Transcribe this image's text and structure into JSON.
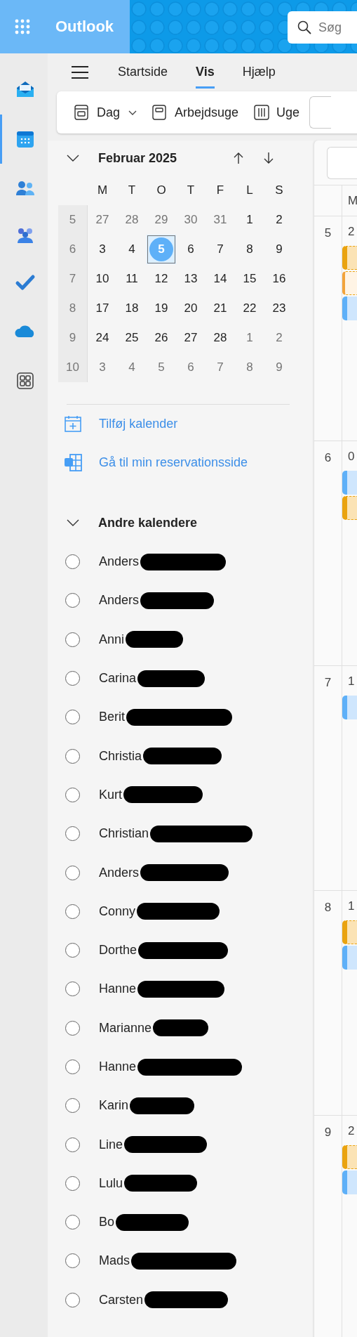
{
  "app": {
    "title": "Outlook"
  },
  "search": {
    "placeholder": "Søg"
  },
  "rail": [
    {
      "kind": "mail",
      "selected": false
    },
    {
      "kind": "calendar",
      "selected": true
    },
    {
      "kind": "people",
      "selected": false
    },
    {
      "kind": "teams",
      "selected": false
    },
    {
      "kind": "todo",
      "selected": false
    },
    {
      "kind": "onedrive",
      "selected": false
    },
    {
      "kind": "apps",
      "selected": false
    }
  ],
  "tabs": [
    {
      "label": "Startside",
      "selected": false
    },
    {
      "label": "Vis",
      "selected": true
    },
    {
      "label": "Hjælp",
      "selected": false
    }
  ],
  "toolbar": [
    {
      "kind": "day",
      "label": "Dag",
      "dropdown": true
    },
    {
      "kind": "workweek",
      "label": "Arbejdsuge",
      "dropdown": false
    },
    {
      "kind": "week",
      "label": "Uge",
      "dropdown": false
    },
    {
      "kind": "cut"
    }
  ],
  "mini_calendar": {
    "title": "Februar 2025",
    "weekdays": [
      "M",
      "T",
      "O",
      "T",
      "F",
      "L",
      "S"
    ],
    "weeks": [
      {
        "week": "5",
        "days": [
          {
            "d": "27",
            "muted": true,
            "selected": false
          },
          {
            "d": "28",
            "muted": true,
            "selected": false
          },
          {
            "d": "29",
            "muted": true,
            "selected": false
          },
          {
            "d": "30",
            "muted": true,
            "selected": false
          },
          {
            "d": "31",
            "muted": true,
            "selected": false
          },
          {
            "d": "1",
            "muted": false,
            "selected": false
          },
          {
            "d": "2",
            "muted": false,
            "selected": false
          }
        ]
      },
      {
        "week": "6",
        "days": [
          {
            "d": "3",
            "muted": false,
            "selected": false
          },
          {
            "d": "4",
            "muted": false,
            "selected": false
          },
          {
            "d": "5",
            "muted": false,
            "selected": true
          },
          {
            "d": "6",
            "muted": false,
            "selected": false
          },
          {
            "d": "7",
            "muted": false,
            "selected": false
          },
          {
            "d": "8",
            "muted": false,
            "selected": false
          },
          {
            "d": "9",
            "muted": false,
            "selected": false
          }
        ]
      },
      {
        "week": "7",
        "days": [
          {
            "d": "10",
            "muted": false,
            "selected": false
          },
          {
            "d": "11",
            "muted": false,
            "selected": false
          },
          {
            "d": "12",
            "muted": false,
            "selected": false
          },
          {
            "d": "13",
            "muted": false,
            "selected": false
          },
          {
            "d": "14",
            "muted": false,
            "selected": false
          },
          {
            "d": "15",
            "muted": false,
            "selected": false
          },
          {
            "d": "16",
            "muted": false,
            "selected": false
          }
        ]
      },
      {
        "week": "8",
        "days": [
          {
            "d": "17",
            "muted": false,
            "selected": false
          },
          {
            "d": "18",
            "muted": false,
            "selected": false
          },
          {
            "d": "19",
            "muted": false,
            "selected": false
          },
          {
            "d": "20",
            "muted": false,
            "selected": false
          },
          {
            "d": "21",
            "muted": false,
            "selected": false
          },
          {
            "d": "22",
            "muted": false,
            "selected": false
          },
          {
            "d": "23",
            "muted": false,
            "selected": false
          }
        ]
      },
      {
        "week": "9",
        "days": [
          {
            "d": "24",
            "muted": false,
            "selected": false
          },
          {
            "d": "25",
            "muted": false,
            "selected": false
          },
          {
            "d": "26",
            "muted": false,
            "selected": false
          },
          {
            "d": "27",
            "muted": false,
            "selected": false
          },
          {
            "d": "28",
            "muted": false,
            "selected": false
          },
          {
            "d": "1",
            "muted": true,
            "selected": false
          },
          {
            "d": "2",
            "muted": true,
            "selected": false
          }
        ]
      },
      {
        "week": "10",
        "days": [
          {
            "d": "3",
            "muted": true,
            "selected": false
          },
          {
            "d": "4",
            "muted": true,
            "selected": false
          },
          {
            "d": "5",
            "muted": true,
            "selected": false
          },
          {
            "d": "6",
            "muted": true,
            "selected": false
          },
          {
            "d": "7",
            "muted": true,
            "selected": false
          },
          {
            "d": "8",
            "muted": true,
            "selected": false
          },
          {
            "d": "9",
            "muted": true,
            "selected": false
          }
        ]
      }
    ]
  },
  "links": [
    {
      "kind": "add",
      "label": "Tilføj kalender"
    },
    {
      "kind": "booking",
      "label": "Gå til min reservationsside"
    }
  ],
  "other_calendars": {
    "title": "Andre kalendere",
    "expanded": true,
    "items": [
      {
        "name": "Anders",
        "checked": false,
        "redacted": true
      },
      {
        "name": "Anders",
        "checked": false,
        "redacted": true
      },
      {
        "name": "Anni",
        "checked": false,
        "redacted": true
      },
      {
        "name": "Carina",
        "checked": false,
        "redacted": true
      },
      {
        "name": "Berit",
        "checked": false,
        "redacted": true
      },
      {
        "name": "Christia",
        "checked": false,
        "redacted": true
      },
      {
        "name": "Kurt",
        "checked": false,
        "redacted": true
      },
      {
        "name": "Christian",
        "checked": false,
        "redacted": true
      },
      {
        "name": "Anders",
        "checked": false,
        "redacted": true
      },
      {
        "name": "Conny",
        "checked": false,
        "redacted": true
      },
      {
        "name": "Dorthe",
        "checked": false,
        "redacted": true
      },
      {
        "name": "Hanne",
        "checked": false,
        "redacted": true
      },
      {
        "name": "Marianne",
        "checked": false,
        "redacted": true
      },
      {
        "name": "Hanne",
        "checked": false,
        "redacted": true
      },
      {
        "name": "Karin",
        "checked": false,
        "redacted": true
      },
      {
        "name": "Line",
        "checked": false,
        "redacted": true
      },
      {
        "name": "Lulu",
        "checked": false,
        "redacted": true
      },
      {
        "name": "Bo",
        "checked": false,
        "redacted": true
      },
      {
        "name": "Mads",
        "checked": false,
        "redacted": true
      },
      {
        "name": "Carsten",
        "checked": false,
        "redacted": true
      }
    ]
  },
  "month_view": {
    "column_1": "M",
    "weeks": [
      {
        "week": "5",
        "day": "2",
        "events": [
          {
            "kind": "tentative"
          },
          {
            "kind": "free"
          },
          {
            "kind": "busy"
          }
        ]
      },
      {
        "week": "6",
        "day": "0",
        "events": [
          {
            "kind": "busy"
          },
          {
            "kind": "tentative"
          }
        ]
      },
      {
        "week": "7",
        "day": "1",
        "events": [
          {
            "kind": "busy"
          }
        ]
      },
      {
        "week": "8",
        "day": "1",
        "events": [
          {
            "kind": "tentative"
          },
          {
            "kind": "busy"
          }
        ]
      },
      {
        "week": "9",
        "day": "2",
        "events": [
          {
            "kind": "tentative"
          },
          {
            "kind": "busy"
          }
        ]
      }
    ]
  }
}
